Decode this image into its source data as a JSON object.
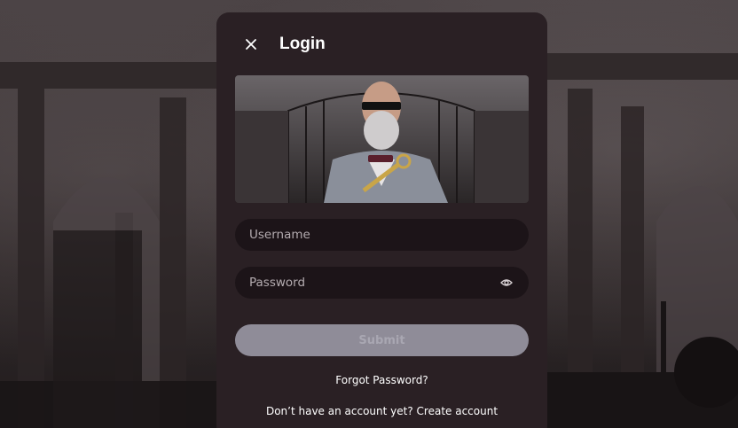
{
  "modal": {
    "title": "Login",
    "close_icon": "close-icon",
    "hero_image": "man-with-key-image"
  },
  "form": {
    "username": {
      "placeholder": "Username",
      "value": ""
    },
    "password": {
      "placeholder": "Password",
      "value": "",
      "toggle_icon": "eye-icon"
    },
    "submit_label": "Submit"
  },
  "links": {
    "forgot_password": "Forgot Password?",
    "signup_prompt": "Don’t have an account yet?",
    "create_account": "Create account"
  },
  "colors": {
    "modal_bg": "#2a2024",
    "field_bg": "#1c1418",
    "submit_bg": "#8f8c98",
    "submit_text": "#a9a7b2",
    "text": "#ffffff"
  }
}
